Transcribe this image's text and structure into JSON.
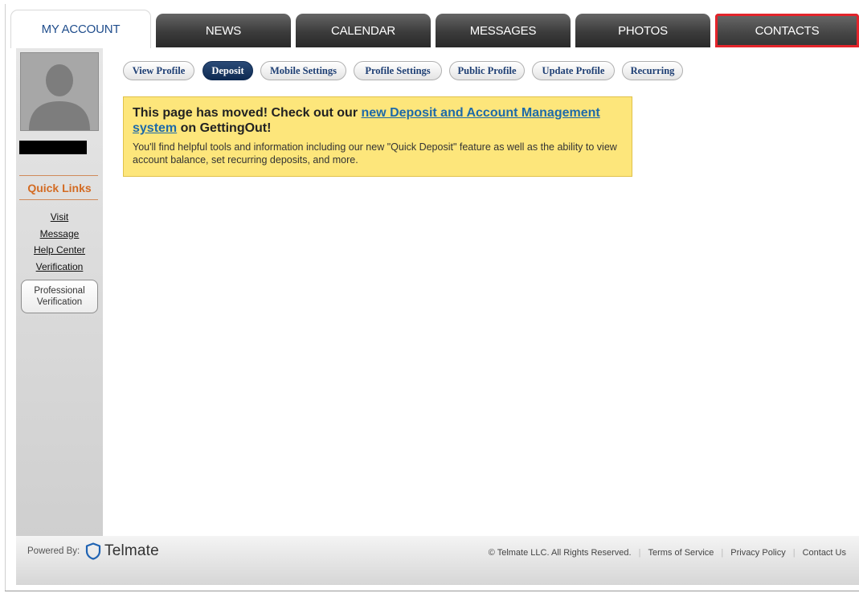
{
  "tabs": [
    {
      "label": "MY ACCOUNT"
    },
    {
      "label": "NEWS"
    },
    {
      "label": "CALENDAR"
    },
    {
      "label": "MESSAGES"
    },
    {
      "label": "PHOTOS"
    },
    {
      "label": "CONTACTS"
    }
  ],
  "sidebar": {
    "quick_links_title": "Quick Links",
    "links": [
      "Visit",
      "Message",
      "Help Center",
      "Verification"
    ],
    "professional_verification_line1": "Professional",
    "professional_verification_line2": "Verification"
  },
  "subnav": [
    {
      "label": "View Profile"
    },
    {
      "label": "Deposit"
    },
    {
      "label": "Mobile Settings"
    },
    {
      "label": "Profile Settings"
    },
    {
      "label": "Public Profile"
    },
    {
      "label": "Update Profile"
    },
    {
      "label": "Recurring"
    }
  ],
  "notice": {
    "head_prefix": "This page has moved! Check out our ",
    "head_link": "new Deposit and Account Management system",
    "head_suffix": " on GettingOut!",
    "body": "You'll find helpful tools and information including our new \"Quick Deposit\" feature as well as the ability to view account balance, set recurring deposits, and more."
  },
  "footer": {
    "powered_by": "Powered By:",
    "logo_text": "Telmate",
    "copyright": "© Telmate LLC. All Rights Reserved.",
    "links": [
      "Terms of Service",
      "Privacy Policy",
      "Contact Us"
    ]
  },
  "colors": {
    "active_tab_text": "#1f4d8c",
    "highlight_outline": "#e3242b",
    "notice_bg": "#fde67b",
    "quick_links": "#d36b23"
  }
}
